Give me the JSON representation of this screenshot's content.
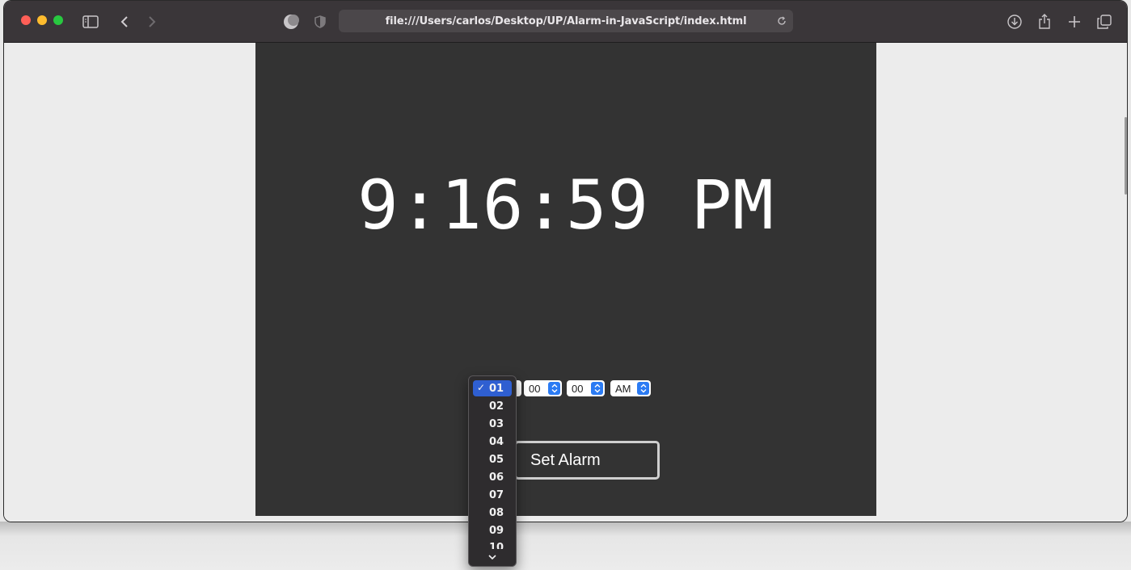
{
  "browser": {
    "url": "file:///Users/carlos/Desktop/UP/Alarm-in-JavaScript/index.html"
  },
  "clock": {
    "time": "9:16:59 PM"
  },
  "alarm": {
    "hour_options": [
      "01",
      "02",
      "03",
      "04",
      "05",
      "06",
      "07",
      "08",
      "09",
      "10"
    ],
    "hour_selected": "01",
    "minute_value": "00",
    "second_value": "00",
    "ampm_value": "AM",
    "check_mark": "✓",
    "set_label": "Set Alarm"
  },
  "colors": {
    "panel_bg": "#333333",
    "accent": "#2b7bf3",
    "selected_item": "#2f5fd1"
  },
  "icons": [
    "sidebar-icon",
    "back-icon",
    "forward-icon",
    "theme-icon",
    "shield-icon",
    "reload-icon",
    "download-icon",
    "share-icon",
    "new-tab-icon",
    "tab-overview-icon",
    "up-down-arrows-icon",
    "chevron-down-icon"
  ]
}
